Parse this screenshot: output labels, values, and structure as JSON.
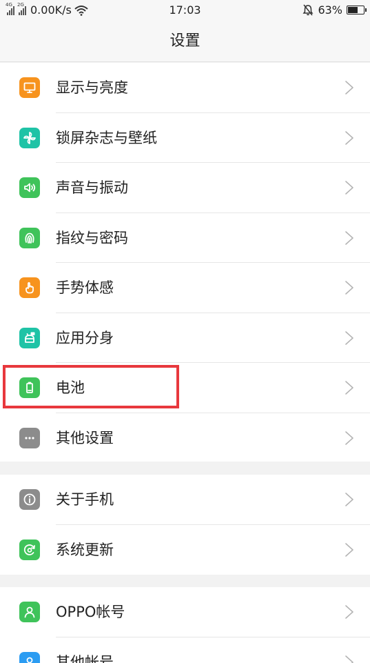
{
  "status": {
    "net_tag_1": "4G",
    "net_tag_2": "2G",
    "speed": "0.00K/s",
    "time": "17:03",
    "battery": "63%",
    "battery_level": 0.63
  },
  "title": "设置",
  "groups": [
    [
      {
        "label": "显示与亮度",
        "icon": "display-icon",
        "color": "#f7931e"
      },
      {
        "label": "锁屏杂志与壁纸",
        "icon": "pinwheel-icon",
        "color": "#1fc3a6"
      },
      {
        "label": "声音与振动",
        "icon": "speaker-icon",
        "color": "#3fc35a"
      },
      {
        "label": "指纹与密码",
        "icon": "fingerprint-icon",
        "color": "#3fc35a"
      },
      {
        "label": "手势体感",
        "icon": "gesture-hand-icon",
        "color": "#f7931e"
      },
      {
        "label": "应用分身",
        "icon": "android-clone-icon",
        "color": "#1fc3a6"
      },
      {
        "label": "电池",
        "icon": "battery-icon",
        "color": "#3fc35a"
      },
      {
        "label": "其他设置",
        "icon": "more-dots-icon",
        "color": "#8c8c8c"
      }
    ],
    [
      {
        "label": "关于手机",
        "icon": "info-icon",
        "color": "#8c8c8c"
      },
      {
        "label": "系统更新",
        "icon": "update-icon",
        "color": "#3fc35a"
      }
    ],
    [
      {
        "label": "OPPO帐号",
        "icon": "user-icon",
        "color": "#3fc35a"
      },
      {
        "label": "其他帐号",
        "icon": "account-icon",
        "color": "#2b9cf2"
      }
    ]
  ]
}
